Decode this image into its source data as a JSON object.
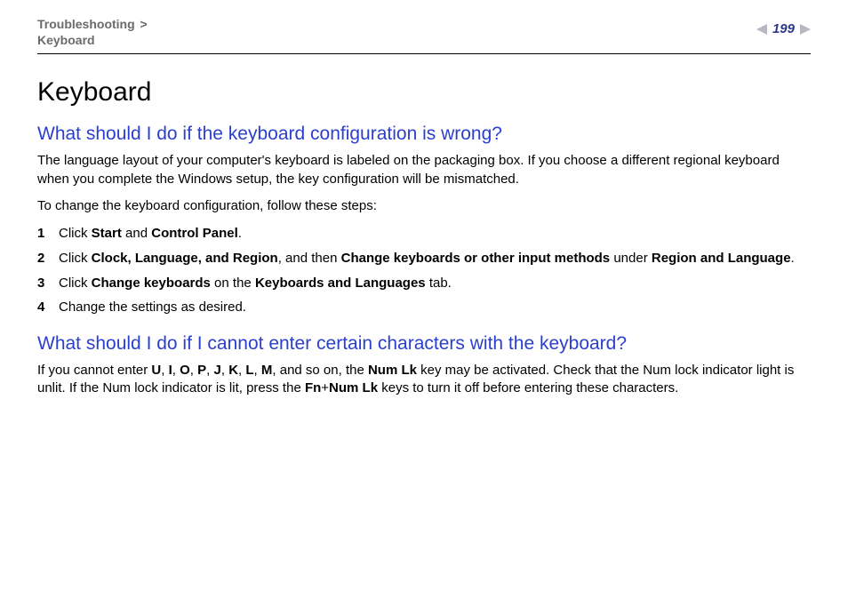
{
  "breadcrumb": {
    "parent": "Troubleshooting",
    "separator": ">",
    "current": "Keyboard"
  },
  "page_number": "199",
  "title": "Keyboard",
  "section1": {
    "heading": "What should I do if the keyboard configuration is wrong?",
    "p1": "The language layout of your computer's keyboard is labeled on the packaging box. If you choose a different regional keyboard when you complete the Windows setup, the key configuration will be mismatched.",
    "p2": "To change the keyboard configuration, follow these steps:",
    "steps": [
      {
        "num": "1",
        "pre": "Click ",
        "b1": "Start",
        "mid": " and ",
        "b2": "Control Panel",
        "post": "."
      },
      {
        "num": "2",
        "pre": "Click ",
        "b1": "Clock, Language, and Region",
        "mid": ", and then ",
        "b2": "Change keyboards or other input methods",
        "mid2": " under ",
        "b3": "Region and Language",
        "post": "."
      },
      {
        "num": "3",
        "pre": "Click ",
        "b1": "Change keyboards",
        "mid": " on the ",
        "b2": "Keyboards and Languages",
        "post": " tab."
      },
      {
        "num": "4",
        "pre": "Change the settings as desired."
      }
    ]
  },
  "section2": {
    "heading": "What should I do if I cannot enter certain characters with the keyboard?",
    "para": {
      "t0": "If you cannot enter ",
      "c1": "U",
      "s": ", ",
      "c2": "I",
      "c3": "O",
      "c4": "P",
      "c5": "J",
      "c6": "K",
      "c7": "L",
      "c8": "M",
      "t1": ", and so on, the ",
      "b1": "Num Lk",
      "t2": " key may be activated. Check that the Num lock indicator light is unlit. If the Num lock indicator is lit, press the ",
      "b2": "Fn",
      "plus": "+",
      "b3": "Num Lk",
      "t3": " keys to turn it off before entering these characters."
    }
  }
}
